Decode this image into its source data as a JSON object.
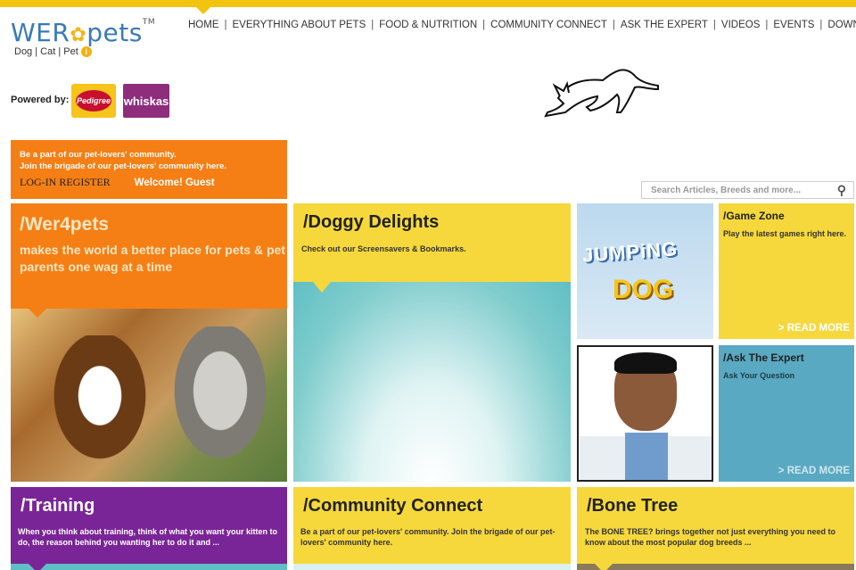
{
  "header": {
    "logo_text": "WER",
    "logo_text2": "pets",
    "logo_tm": "TM",
    "logo_sub": "Dog | Cat | Pet",
    "nav": [
      "HOME",
      "EVERYTHING ABOUT PETS",
      "FOOD & NUTRITION",
      "COMMUNITY CONNECT",
      "ASK THE EXPERT",
      "VIDEOS",
      "EVENTS",
      "DOWNLOADS"
    ],
    "nav_sep": "|",
    "powered_by": "Powered by:",
    "brand1": "Pedigree",
    "brand2": "whiskas"
  },
  "community": {
    "line1": "Be a part of our pet-lovers' community.",
    "line2": "Join the brigade of our pet-lovers' community here.",
    "login": "LOG-IN",
    "register": "REGISTER",
    "welcome": "Welcome! Guest"
  },
  "search": {
    "placeholder": "Search Articles, Breeds and more..."
  },
  "tiles": {
    "wer": {
      "title": "/Wer4pets",
      "tagline": "makes the world a better place for pets & pet parents one wag at a time"
    },
    "doggy": {
      "title": "/Doggy Delights",
      "desc": "Check out our Screensavers & Bookmarks."
    },
    "jumping": {
      "line1": "JUMPiNG",
      "line2": "DOG"
    },
    "game": {
      "title": "/Game Zone",
      "desc": "Play the latest games right here.",
      "read_more": "> READ MORE"
    },
    "ask": {
      "title": "/Ask The Expert",
      "desc": "Ask Your Question",
      "read_more": "> READ MORE"
    },
    "training": {
      "title": "/Training",
      "desc": "When you think about training, think of what you want your kitten to do, the reason behind you wanting her to do it and ..."
    },
    "comm": {
      "title": "/Community Connect",
      "desc": "Be a part of our pet-lovers' community. Join the brigade of our pet-lovers' community here."
    },
    "bone": {
      "title": "/Bone Tree",
      "desc": "The BONE TREE? brings together not just everything you need to know about the most popular dog breeds ..."
    }
  },
  "colors": {
    "orange": "#f57f14",
    "yellow": "#f6d83c",
    "purple": "#7a2597",
    "teal": "#5aa9c2",
    "gold": "#f2c40f"
  }
}
